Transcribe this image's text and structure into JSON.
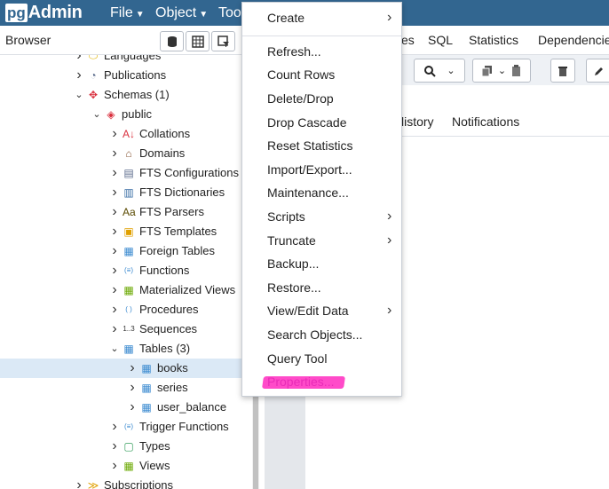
{
  "app": {
    "logo_pg": "pg",
    "logo_admin": "Admin",
    "menus": [
      "File",
      "Object",
      "Too"
    ]
  },
  "browser": {
    "title": "Browser"
  },
  "right_panel": {
    "tabs": [
      "es",
      "SQL",
      "Statistics",
      "Dependencie"
    ],
    "subtabs": [
      "listory",
      "Notifications"
    ]
  },
  "tree": [
    {
      "label": "Languages",
      "indent": 1,
      "chevron": "right",
      "icon": "languages-icon",
      "glyph": "⬭",
      "color": "#e0b400"
    },
    {
      "label": "Publications",
      "indent": 1,
      "chevron": "right",
      "icon": "publications-icon",
      "glyph": "◔",
      "color": "#5b6b8c"
    },
    {
      "label": "Schemas (1)",
      "indent": 1,
      "chevron": "down",
      "icon": "schemas-icon",
      "glyph": "✥",
      "color": "#d9303e"
    },
    {
      "label": "public",
      "indent": 2,
      "chevron": "down",
      "icon": "schema-icon",
      "glyph": "◈",
      "color": "#d9303e"
    },
    {
      "label": "Collations",
      "indent": 3,
      "chevron": "right",
      "icon": "collations-icon",
      "glyph": "A↓",
      "color": "#d9303e"
    },
    {
      "label": "Domains",
      "indent": 3,
      "chevron": "right",
      "icon": "domains-icon",
      "glyph": "⌂",
      "color": "#8a5a3a"
    },
    {
      "label": "FTS Configurations",
      "indent": 3,
      "chevron": "right",
      "icon": "fts-configurations-icon",
      "glyph": "▤",
      "color": "#5b6b8c"
    },
    {
      "label": "FTS Dictionaries",
      "indent": 3,
      "chevron": "right",
      "icon": "fts-dictionaries-icon",
      "glyph": "▥",
      "color": "#3a6ea5"
    },
    {
      "label": "FTS Parsers",
      "indent": 3,
      "chevron": "right",
      "icon": "fts-parsers-icon",
      "glyph": "Aa",
      "color": "#5a4a00"
    },
    {
      "label": "FTS Templates",
      "indent": 3,
      "chevron": "right",
      "icon": "fts-templates-icon",
      "glyph": "▣",
      "color": "#e0a000"
    },
    {
      "label": "Foreign Tables",
      "indent": 3,
      "chevron": "right",
      "icon": "foreign-tables-icon",
      "glyph": "▦",
      "color": "#3a8ad0"
    },
    {
      "label": "Functions",
      "indent": 3,
      "chevron": "right",
      "icon": "functions-icon",
      "glyph": "(≡)",
      "color": "#3a8ad0"
    },
    {
      "label": "Materialized Views",
      "indent": 3,
      "chevron": "right",
      "icon": "materialized-views-icon",
      "glyph": "▦",
      "color": "#6aa800"
    },
    {
      "label": "Procedures",
      "indent": 3,
      "chevron": "right",
      "icon": "procedures-icon",
      "glyph": "( )",
      "color": "#3a8ad0"
    },
    {
      "label": "Sequences",
      "indent": 3,
      "chevron": "right",
      "icon": "sequences-icon",
      "glyph": "1..3",
      "color": "#333333"
    },
    {
      "label": "Tables (3)",
      "indent": 3,
      "chevron": "down",
      "icon": "tables-icon",
      "glyph": "▦",
      "color": "#3a8ad0"
    },
    {
      "label": "books",
      "indent": 4,
      "chevron": "right",
      "icon": "table-icon",
      "glyph": "▦",
      "color": "#3a8ad0",
      "selected": true
    },
    {
      "label": "series",
      "indent": 4,
      "chevron": "right",
      "icon": "table-icon",
      "glyph": "▦",
      "color": "#3a8ad0"
    },
    {
      "label": "user_balance",
      "indent": 4,
      "chevron": "right",
      "icon": "table-icon",
      "glyph": "▦",
      "color": "#3a8ad0"
    },
    {
      "label": "Trigger Functions",
      "indent": 3,
      "chevron": "right",
      "icon": "trigger-functions-icon",
      "glyph": "(≡)",
      "color": "#3a8ad0"
    },
    {
      "label": "Types",
      "indent": 3,
      "chevron": "right",
      "icon": "types-icon",
      "glyph": "▢",
      "color": "#3aa060"
    },
    {
      "label": "Views",
      "indent": 3,
      "chevron": "right",
      "icon": "views-icon",
      "glyph": "▦",
      "color": "#6aa800"
    },
    {
      "label": "Subscriptions",
      "indent": 1,
      "chevron": "right",
      "icon": "subscriptions-icon",
      "glyph": "≫",
      "color": "#e0a000"
    }
  ],
  "context_menu": [
    {
      "label": "Create",
      "submenu": true
    },
    {
      "label": "Refresh...",
      "submenu": false
    },
    {
      "label": "Count Rows",
      "submenu": false
    },
    {
      "label": "Delete/Drop",
      "submenu": false
    },
    {
      "label": "Drop Cascade",
      "submenu": false
    },
    {
      "label": "Reset Statistics",
      "submenu": false
    },
    {
      "label": "Import/Export...",
      "submenu": false
    },
    {
      "label": "Maintenance...",
      "submenu": false
    },
    {
      "label": "Scripts",
      "submenu": true
    },
    {
      "label": "Truncate",
      "submenu": true
    },
    {
      "label": "Backup...",
      "submenu": false
    },
    {
      "label": "Restore...",
      "submenu": false
    },
    {
      "label": "View/Edit Data",
      "submenu": true
    },
    {
      "label": "Search Objects...",
      "submenu": false
    },
    {
      "label": "Query Tool",
      "submenu": false
    },
    {
      "label": "Properties...",
      "submenu": false,
      "highlighted": true
    }
  ],
  "colors": {
    "topbar": "#326690",
    "selection": "#dbe9f6",
    "highlighter": "#ff2bbf"
  }
}
